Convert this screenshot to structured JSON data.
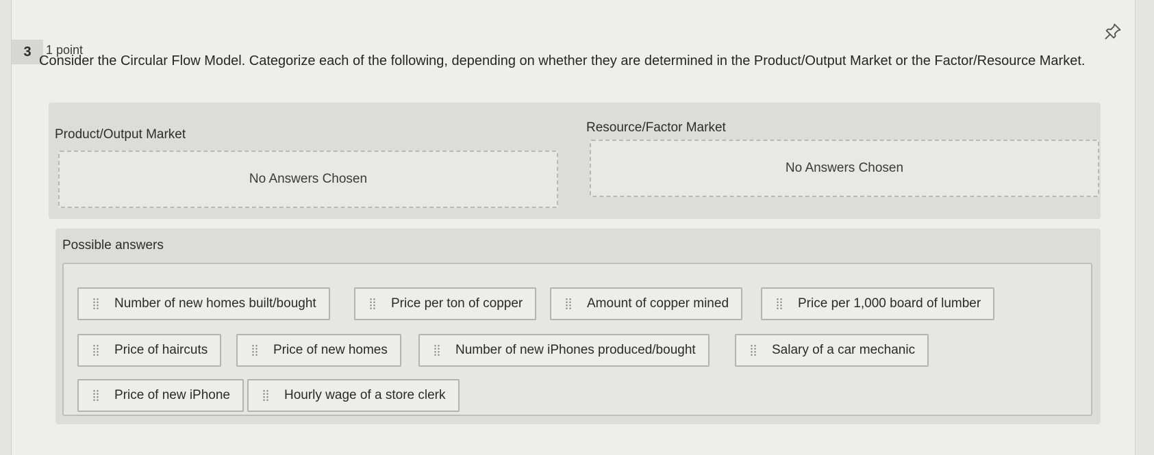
{
  "question": {
    "number": "3",
    "points": "1 point",
    "prompt": "Consider the Circular Flow Model. Categorize each of the following, depending on whether they are determined in the Product/Output Market or the Factor/Resource Market."
  },
  "categories": [
    {
      "title": "Product/Output Market",
      "empty_text": "No Answers Chosen"
    },
    {
      "title": "Resource/Factor Market",
      "empty_text": "No Answers Chosen"
    }
  ],
  "possible_answers": {
    "title": "Possible answers",
    "items": [
      {
        "label": "Number of new homes built/bought"
      },
      {
        "label": "Price per ton of copper"
      },
      {
        "label": "Amount of copper mined"
      },
      {
        "label": "Price per 1,000 board of lumber"
      },
      {
        "label": "Price of haircuts"
      },
      {
        "label": "Price of new homes"
      },
      {
        "label": "Number of new iPhones produced/bought"
      },
      {
        "label": "Salary of a car mechanic"
      },
      {
        "label": "Price of new iPhone"
      },
      {
        "label": "Hourly wage of a store clerk"
      }
    ]
  },
  "icons": {
    "pin": "pin-icon",
    "drag": "drag-handle-icon"
  }
}
